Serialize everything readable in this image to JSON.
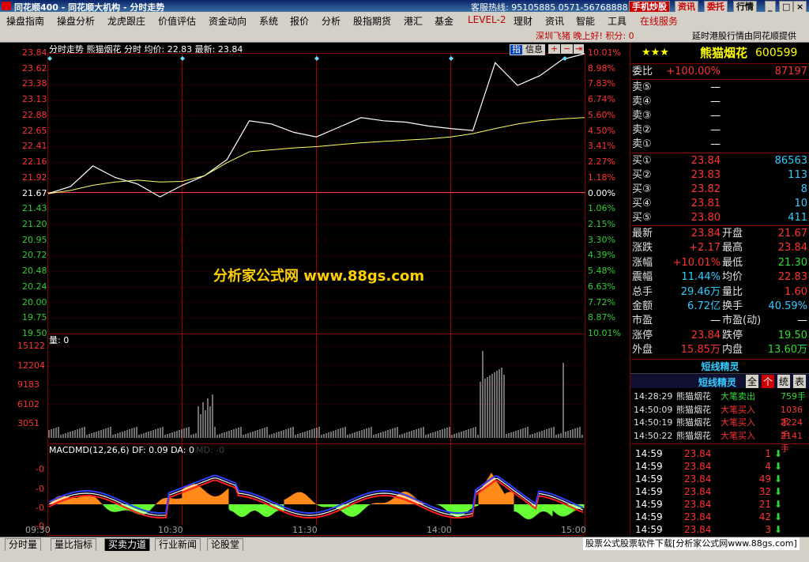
{
  "window": {
    "title": "同花顺400 - 同花顺大机构 - 分时走势",
    "hotline": "客服热线: 95105885  0571-56768888",
    "buttons": [
      "手机炒股",
      "资讯",
      "委托",
      "行情"
    ]
  },
  "menu": [
    "操盘指南",
    "操盘分析",
    "龙虎跟庄",
    "价值评估",
    "资金动向",
    "系统",
    "报价",
    "分析",
    "股指期货",
    "港汇",
    "基金",
    "LEVEL-2",
    "理财",
    "资讯",
    "智能",
    "工具",
    "在线服务"
  ],
  "infobar": {
    "greeting": "深圳飞猪  晚上好!  积分: 0",
    "notice": "延时港股行情由同花顺提供"
  },
  "chart_header": {
    "text": "分时走势   熊猫烟花 分时 均价: 22.83 最新: 23.84",
    "icons": [
      "指",
      "信息"
    ]
  },
  "price_axis": [
    "23.84",
    "23.62",
    "23.38",
    "23.13",
    "22.88",
    "22.65",
    "22.41",
    "22.16",
    "21.92",
    "21.67",
    "21.43",
    "21.20",
    "20.95",
    "20.72",
    "20.48",
    "20.24",
    "20.00",
    "19.75",
    "19.50"
  ],
  "pct_axis": [
    "10.01%",
    "8.98%",
    "7.83%",
    "6.74%",
    "5.60%",
    "4.50%",
    "3.41%",
    "2.27%",
    "1.18%",
    "0.00%",
    "1.06%",
    "2.15%",
    "3.30%",
    "4.39%",
    "5.48%",
    "6.63%",
    "7.72%",
    "8.87%",
    "10.01%"
  ],
  "volume": {
    "label": "量: 0",
    "axis": [
      "15122",
      "12204",
      "9183",
      "6102",
      "3051"
    ]
  },
  "macd": {
    "title": "MACDMD(12,26,6) DF: 0.09 DA: 0",
    "md": "MD: -0",
    "axis": [
      "-0",
      "-0",
      "-0",
      "-0"
    ]
  },
  "time_axis": [
    "09:30",
    "10:30",
    "11:30",
    "14:00",
    "15:00"
  ],
  "chart_data": {
    "type": "line",
    "x": [
      "09:30",
      "09:40",
      "09:50",
      "10:00",
      "10:10",
      "10:20",
      "10:30",
      "10:40",
      "10:50",
      "11:00",
      "11:10",
      "11:20",
      "11:30",
      "13:10",
      "13:20",
      "13:30",
      "13:40",
      "13:50",
      "14:00",
      "14:10",
      "14:20",
      "14:30",
      "14:40",
      "14:50",
      "15:00"
    ],
    "series": [
      {
        "values": [
          21.67,
          21.78,
          22.1,
          21.92,
          21.82,
          21.62,
          21.8,
          21.95,
          22.2,
          22.8,
          22.75,
          22.62,
          22.55,
          22.7,
          22.85,
          22.8,
          22.78,
          22.72,
          22.68,
          22.65,
          23.7,
          23.35,
          23.5,
          23.75,
          23.84
        ]
      },
      {
        "values": [
          21.67,
          21.72,
          21.8,
          21.85,
          21.88,
          21.85,
          21.86,
          21.95,
          22.15,
          22.32,
          22.35,
          22.38,
          22.4,
          22.43,
          22.46,
          22.48,
          22.5,
          22.52,
          22.55,
          22.6,
          22.68,
          22.75,
          22.8,
          22.83,
          22.85
        ]
      }
    ],
    "ylim": [
      19.5,
      23.84
    ]
  },
  "watermark": "分析家公式网  www.88gs.com",
  "stock": {
    "stars": "★★★",
    "name": "熊猫烟花",
    "code": "600599"
  },
  "order_book": {
    "weibi": {
      "label": "委比",
      "value": "+100.00%",
      "extra": "87197"
    },
    "asks": [
      {
        "l": "卖⑤",
        "p": "—"
      },
      {
        "l": "卖④",
        "p": "—"
      },
      {
        "l": "卖③",
        "p": "—"
      },
      {
        "l": "卖②",
        "p": "—"
      },
      {
        "l": "卖①",
        "p": "—"
      }
    ],
    "bids": [
      {
        "l": "买①",
        "p": "23.84",
        "v": "86563"
      },
      {
        "l": "买②",
        "p": "23.83",
        "v": "113"
      },
      {
        "l": "买③",
        "p": "23.82",
        "v": "8"
      },
      {
        "l": "买④",
        "p": "23.81",
        "v": "10"
      },
      {
        "l": "买⑤",
        "p": "23.80",
        "v": "411"
      }
    ]
  },
  "quote": [
    {
      "l1": "最新",
      "v1": "23.84",
      "l2": "开盘",
      "v2": "21.67"
    },
    {
      "l1": "涨跌",
      "v1": "+2.17",
      "l2": "最高",
      "v2": "23.84"
    },
    {
      "l1": "涨幅",
      "v1": "+10.01%",
      "l2": "最低",
      "v2": "21.30"
    },
    {
      "l1": "震幅",
      "v1": "11.44%",
      "l2": "均价",
      "v2": "22.83"
    },
    {
      "l1": "总手",
      "v1": "29.46万",
      "l2": "量比",
      "v2": "1.60"
    },
    {
      "l1": "金额",
      "v1": "6.72亿",
      "l2": "换手",
      "v2": "40.59%"
    },
    {
      "l1": "市盈",
      "v1": "—",
      "l2": "市盈(动)",
      "v2": "—"
    },
    {
      "l1": "涨停",
      "v1": "23.84",
      "l2": "跌停",
      "v2": "19.50"
    },
    {
      "l1": "外盘",
      "v1": "15.85万",
      "l2": "内盘",
      "v2": "13.60万"
    }
  ],
  "jingling": {
    "title": "短线精灵",
    "subtitle": "短线精灵",
    "btns": [
      "全",
      "个",
      "统",
      "表"
    ],
    "rows": [
      {
        "t": "14:28:29",
        "n": "熊猫烟花",
        "e": "大笔卖出",
        "v": "759手"
      },
      {
        "t": "14:50:09",
        "n": "熊猫烟花",
        "e": "大笔买入",
        "v": "1036手"
      },
      {
        "t": "14:50:19",
        "n": "熊猫烟花",
        "e": "大笔买入",
        "v": "2224手"
      },
      {
        "t": "14:50:22",
        "n": "熊猫烟花",
        "e": "大笔买入",
        "v": "2141手"
      }
    ]
  },
  "ticks": [
    {
      "t": "14:59",
      "p": "23.84",
      "v": "1"
    },
    {
      "t": "14:59",
      "p": "23.84",
      "v": "4"
    },
    {
      "t": "14:59",
      "p": "23.84",
      "v": "49"
    },
    {
      "t": "14:59",
      "p": "23.84",
      "v": "32"
    },
    {
      "t": "14:59",
      "p": "23.84",
      "v": "21"
    },
    {
      "t": "14:59",
      "p": "23.84",
      "v": "42"
    },
    {
      "t": "14:59",
      "p": "23.84",
      "v": "3"
    }
  ],
  "tabs": [
    "分时量",
    "量比指标",
    "买卖力道",
    "行业新闻",
    "论股堂"
  ],
  "status": "股票公式股票软件下载[分析家公式网www.88gs.com]"
}
